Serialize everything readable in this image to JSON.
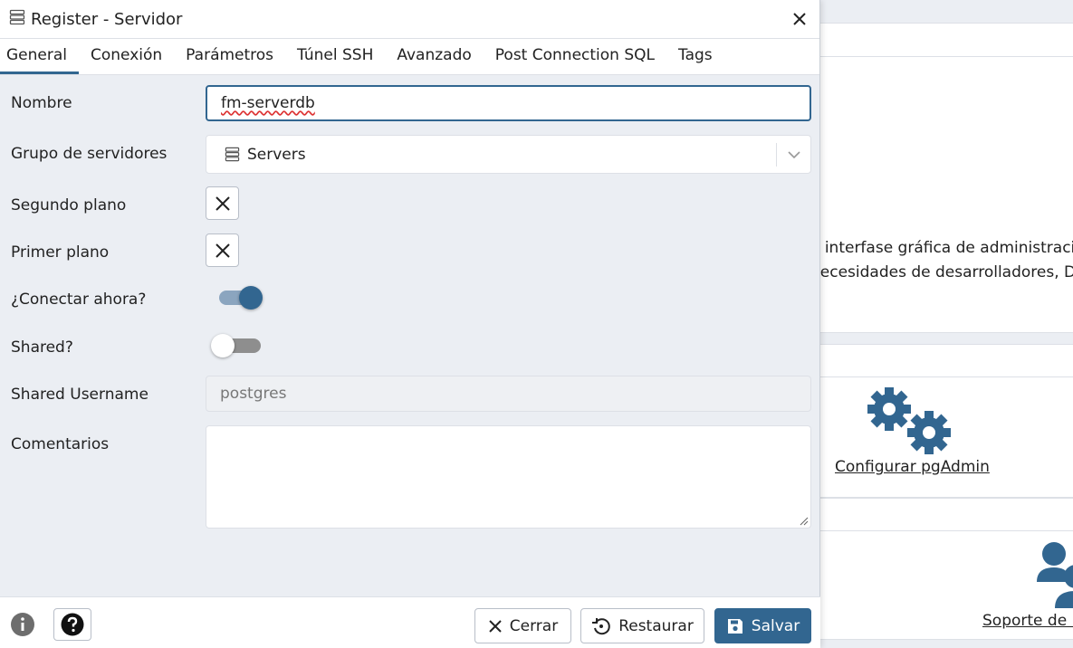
{
  "dialog": {
    "title": "Register - Servidor",
    "tabs": [
      "General",
      "Conexión",
      "Parámetros",
      "Túnel SSH",
      "Avanzado",
      "Post Connection SQL",
      "Tags"
    ],
    "active_tab": "General"
  },
  "form": {
    "name_label": "Nombre",
    "name_value": "fm-serverdb",
    "group_label": "Grupo de servidores",
    "group_value": "Servers",
    "background_label": "Segundo plano",
    "foreground_label": "Primer plano",
    "connect_now_label": "¿Conectar ahora?",
    "connect_now": true,
    "shared_label": "Shared?",
    "shared": false,
    "shared_username_label": "Shared Username",
    "shared_username_value": "postgres",
    "comments_label": "Comentarios",
    "comments_value": ""
  },
  "footer": {
    "close_label": "Cerrar",
    "reset_label": "Restaurar",
    "save_label": "Salvar"
  },
  "background": {
    "desc_line1": "a interfase gráfica de administraci",
    "desc_line2": "necesidades de desarrolladores, D",
    "config_link": "Configurar pgAdmin",
    "support_link": "Soporte de l"
  },
  "colors": {
    "accent": "#326690"
  }
}
